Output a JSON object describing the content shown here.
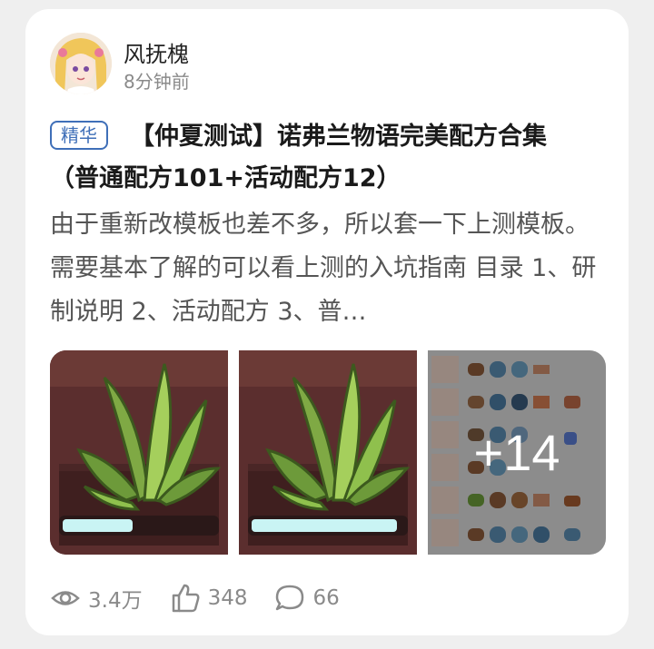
{
  "author": {
    "name": "风抚槐",
    "time": "8分钟前"
  },
  "post": {
    "badge": "精华",
    "title": "【仲夏测试】诺弗兰物语完美配方合集（普通配方101+活动配方12）",
    "excerpt": "由于重新改模板也差不多，所以套一下上测模板。需要基本了解的可以看上测的入坑指南 目录 1、研制说明 2、活动配方 3、普…"
  },
  "images": {
    "more_count": "+14",
    "progress": [
      0.46,
      0.95
    ]
  },
  "stats": {
    "views": "3.4万",
    "likes": "348",
    "comments": "66"
  },
  "colors": {
    "badge": "#3f6fb8",
    "thumb_bg": "#5b2e2e",
    "herb_green": "#8fc04d"
  }
}
